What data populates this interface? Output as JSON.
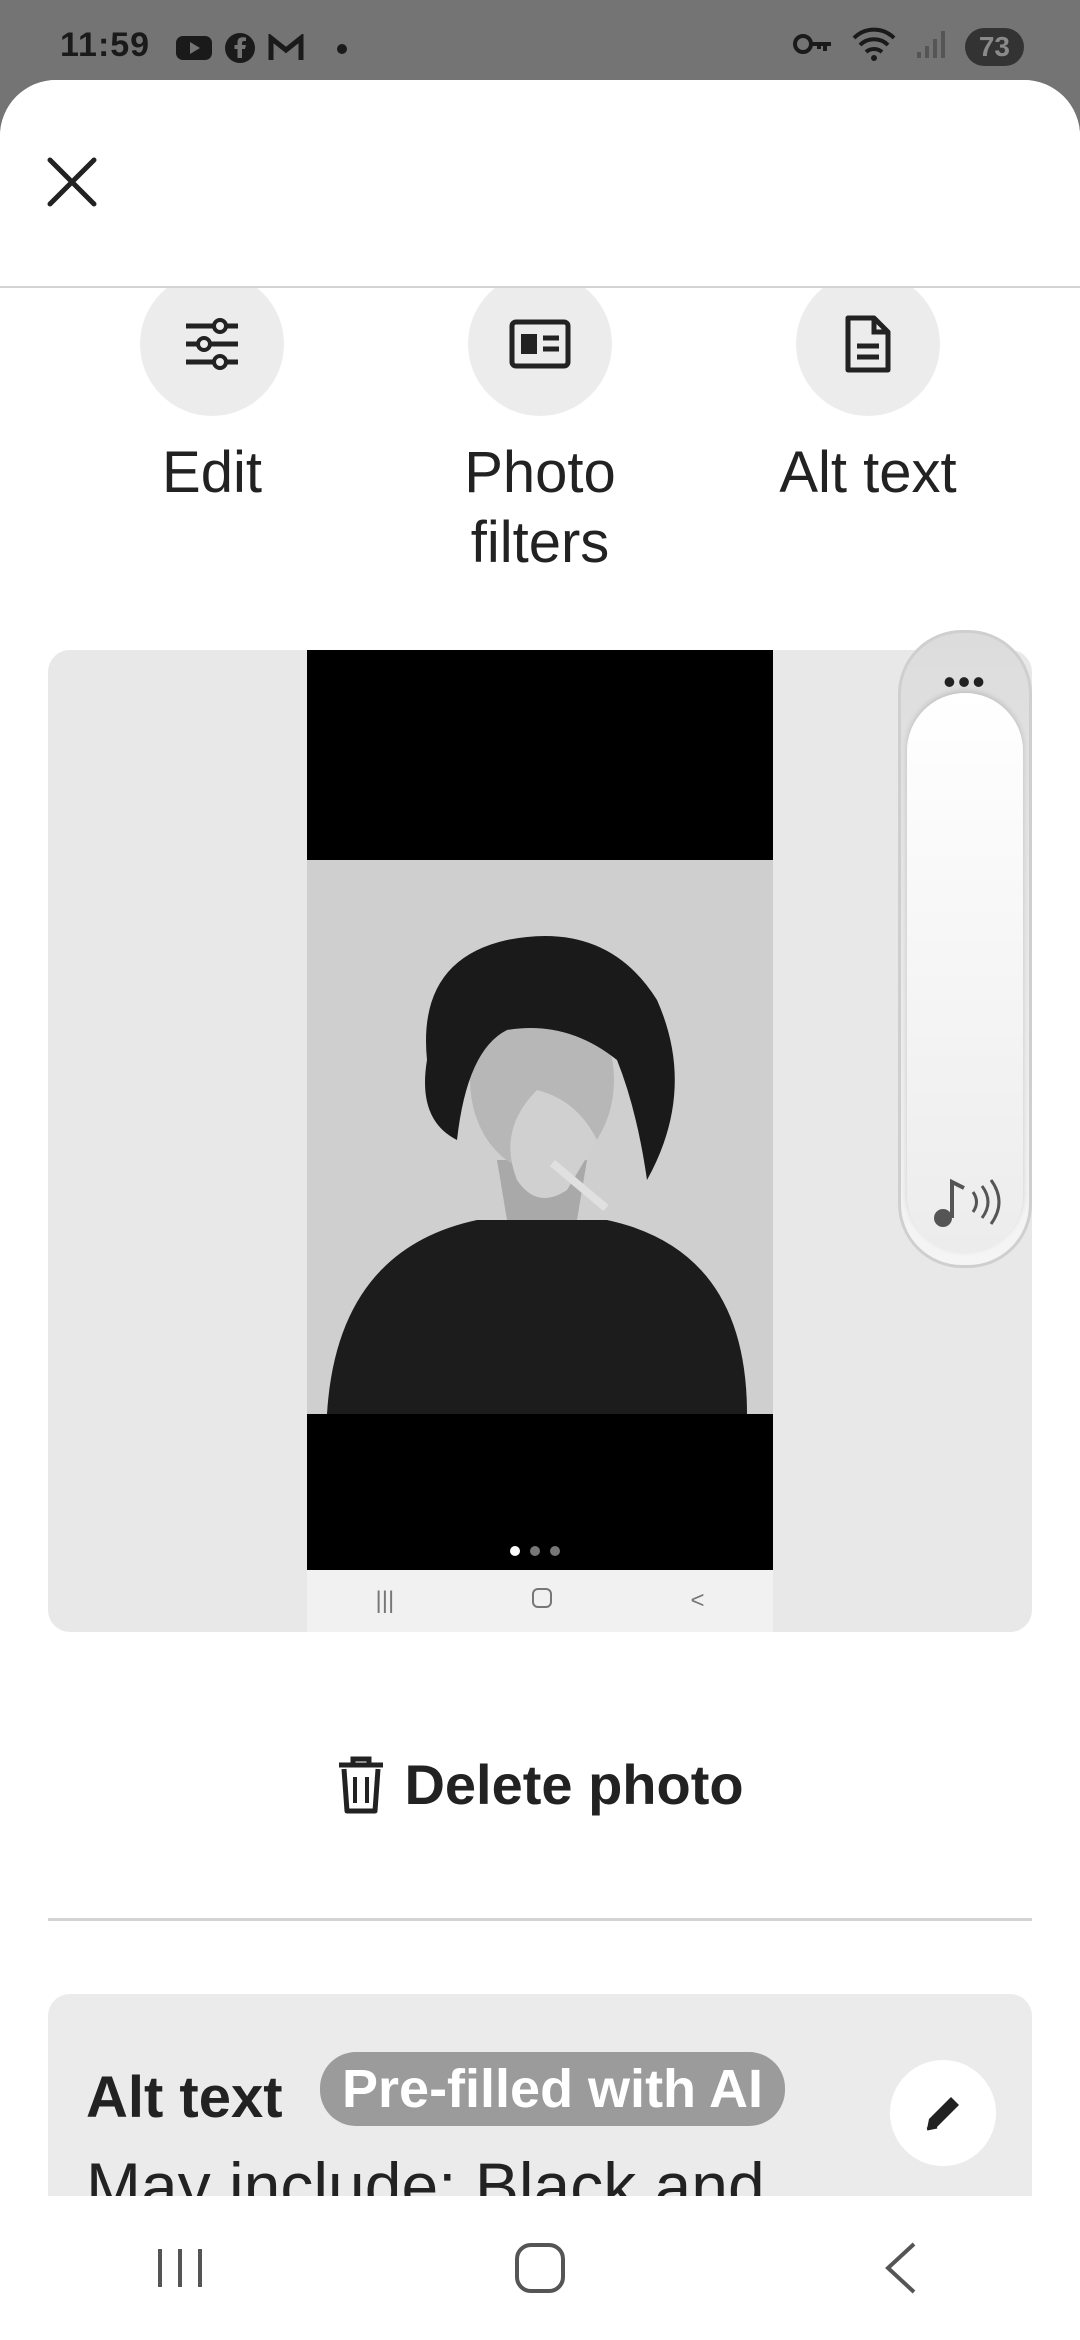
{
  "status_bar": {
    "time": "11:59",
    "battery": "73",
    "notification_icons": [
      "youtube-icon",
      "facebook-icon",
      "gmail-icon",
      "dot-icon"
    ],
    "system_icons": [
      "key-icon",
      "wifi-icon",
      "signal-icon",
      "battery-icon"
    ]
  },
  "actions": [
    {
      "label": "Edit",
      "icon": "sliders-icon"
    },
    {
      "label": "Photo filters",
      "label_lines": [
        "Photo",
        "filters"
      ],
      "icon": "photo-filter-icon"
    },
    {
      "label": "Alt text",
      "icon": "document-icon"
    }
  ],
  "preview": {
    "page_dots": 3,
    "active_dot": 1
  },
  "volume_panel": {
    "more_label": "•••"
  },
  "delete": {
    "label": "Delete photo"
  },
  "alt_text": {
    "title": "Alt text",
    "badge": "Pre-filled with AI",
    "body": "May include: Black and white portrait of a"
  },
  "colors": {
    "background_dim": "#747474",
    "sheet": "#ffffff",
    "card": "#ebebeb",
    "badge": "#9b9b9b"
  }
}
